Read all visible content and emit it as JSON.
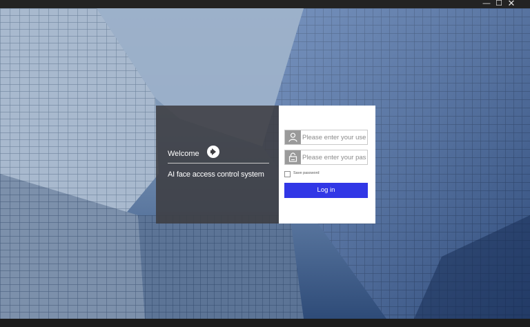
{
  "window": {
    "minimize_glyph": "—",
    "maximize_glyph": "☐",
    "close_glyph": "✕"
  },
  "welcome": {
    "title": "Welcome",
    "subtitle": "AI face access control system",
    "arrow_icon": "arrow-right-circle-icon"
  },
  "login": {
    "username_placeholder": "Please enter your user name",
    "password_placeholder": "Please enter your password",
    "save_password_label": "Save password",
    "save_password_checked": false,
    "login_button_label": "Log in",
    "user_icon": "user-icon",
    "lock_icon": "lock-icon"
  },
  "colors": {
    "accent": "#3137e6",
    "welcome_panel": "#3e3e42",
    "icon_bg": "#9a9a9a"
  }
}
